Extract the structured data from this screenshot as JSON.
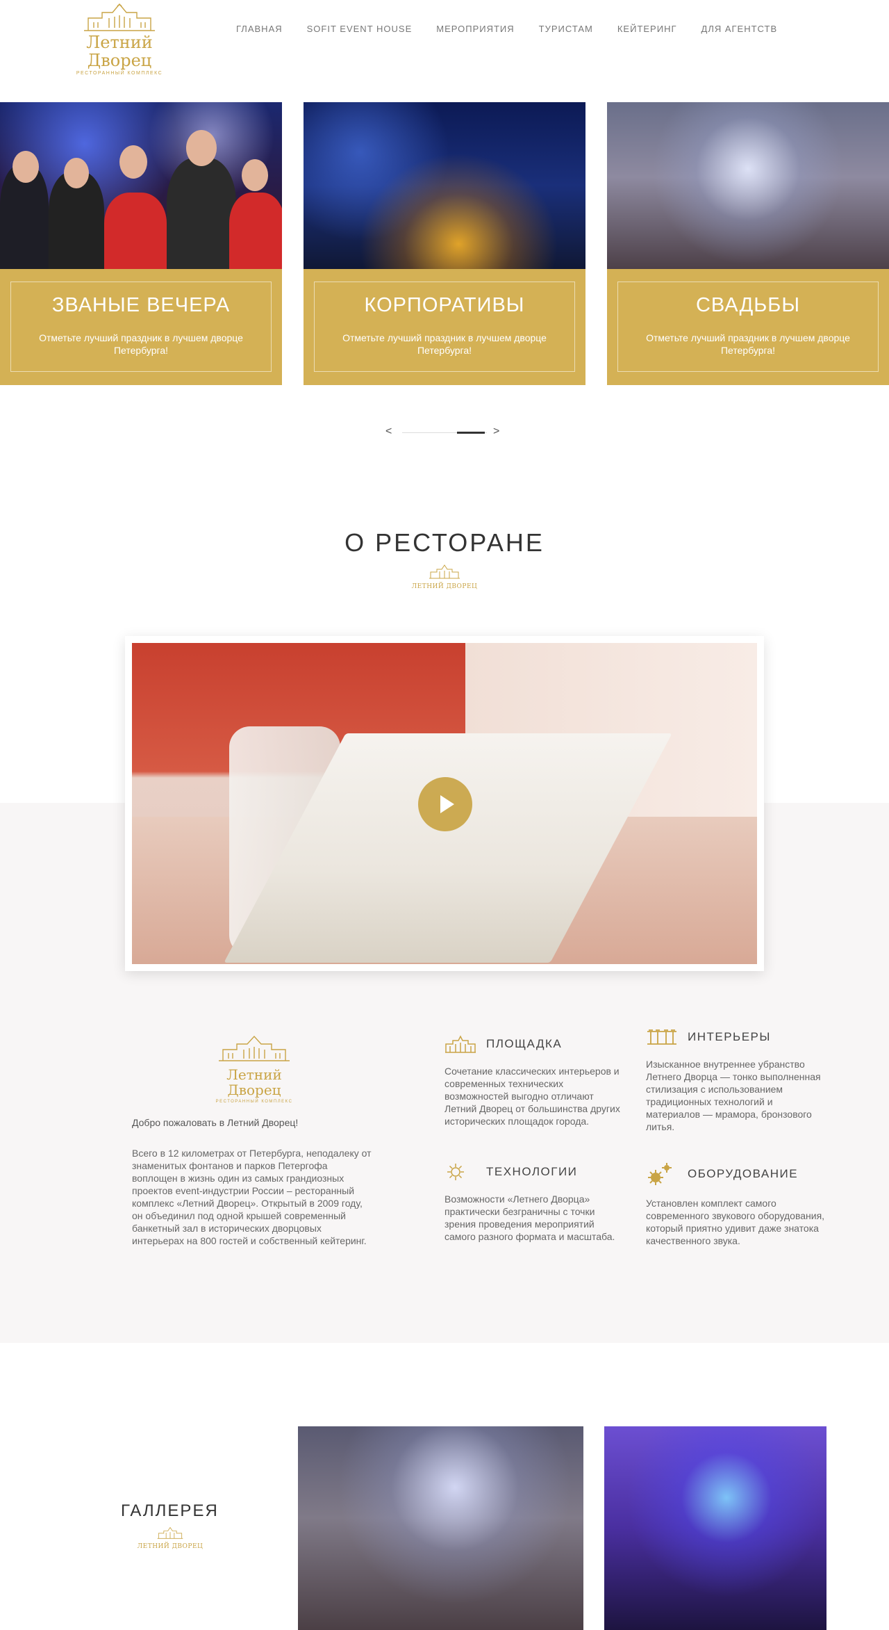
{
  "brand": {
    "name": "Летний Дворец",
    "subtitle": "РЕСТОРАННЫЙ КОМПЛЕКС",
    "mini_name": "ЛЕТНИЙ ДВОРЕЦ",
    "gold": "#c9a445"
  },
  "nav": {
    "items": [
      {
        "label": "ГЛАВНАЯ"
      },
      {
        "label": "SOFIT EVENT HOUSE"
      },
      {
        "label": "МЕРОПРИЯТИЯ"
      },
      {
        "label": "ТУРИСТАМ"
      },
      {
        "label": "КЕЙТЕРИНГ"
      },
      {
        "label": "ДЛЯ АГЕНТСТВ"
      }
    ]
  },
  "slider": {
    "cards": [
      {
        "title": "ЗВАНЫЕ ВЕЧЕРА",
        "desc": "Отметьте лучший праздник в лучшем дворце Петербурга!"
      },
      {
        "title": "КОРПОРАТИВЫ",
        "desc": "Отметьте лучший праздник в лучшем дворце Петербурга!"
      },
      {
        "title": "СВАДЬБЫ",
        "desc": "Отметьте лучший праздник в лучшем дворце Петербурга!"
      }
    ],
    "prev": "<",
    "next": ">"
  },
  "about": {
    "title": "О РЕСТОРАНЕ",
    "welcome": "Добро пожаловать в Летний Дворец!",
    "text": "Всего в 12 километрах от Петербурга, неподалеку от знаменитых фонтанов и парков Петергофа воплощен в жизнь один из самых грандиозных проектов event-индустрии России – ресторанный комплекс «Летний Дворец». Открытый в 2009 году, он объединил под одной крышей современный банкетный зал в исторических дворцовых интерьерах на 800 гостей и собственный кейтеринг.",
    "features": [
      {
        "title": "ПЛОЩАДКА",
        "icon": "palace-icon",
        "desc": "Сочетание классических интерьеров и современных технических возможностей выгодно отличают Летний Дворец от большинства других исторических площадок города."
      },
      {
        "title": "ИНТЕРЬЕРЫ",
        "icon": "columns-icon",
        "desc": "Изысканное внутреннее убранство Летнего Дворца — тонко выполненная стилизация с использованием традиционных технологий и материалов — мрамора, бронзового литья."
      },
      {
        "title": "ТЕХНОЛОГИИ",
        "icon": "sun-icon",
        "desc": "Возможности «Летнего Дворца» практически безграничны с точки зрения проведения мероприятий самого разного формата и масштаба."
      },
      {
        "title": "ОБОРУДОВАНИЕ",
        "icon": "gears-icon",
        "desc": "Установлен комплект самого современного звукового оборудования, который приятно удивит даже знатока качественного звука."
      }
    ]
  },
  "gallery": {
    "title": "ГАЛЛЕРЕЯ"
  }
}
